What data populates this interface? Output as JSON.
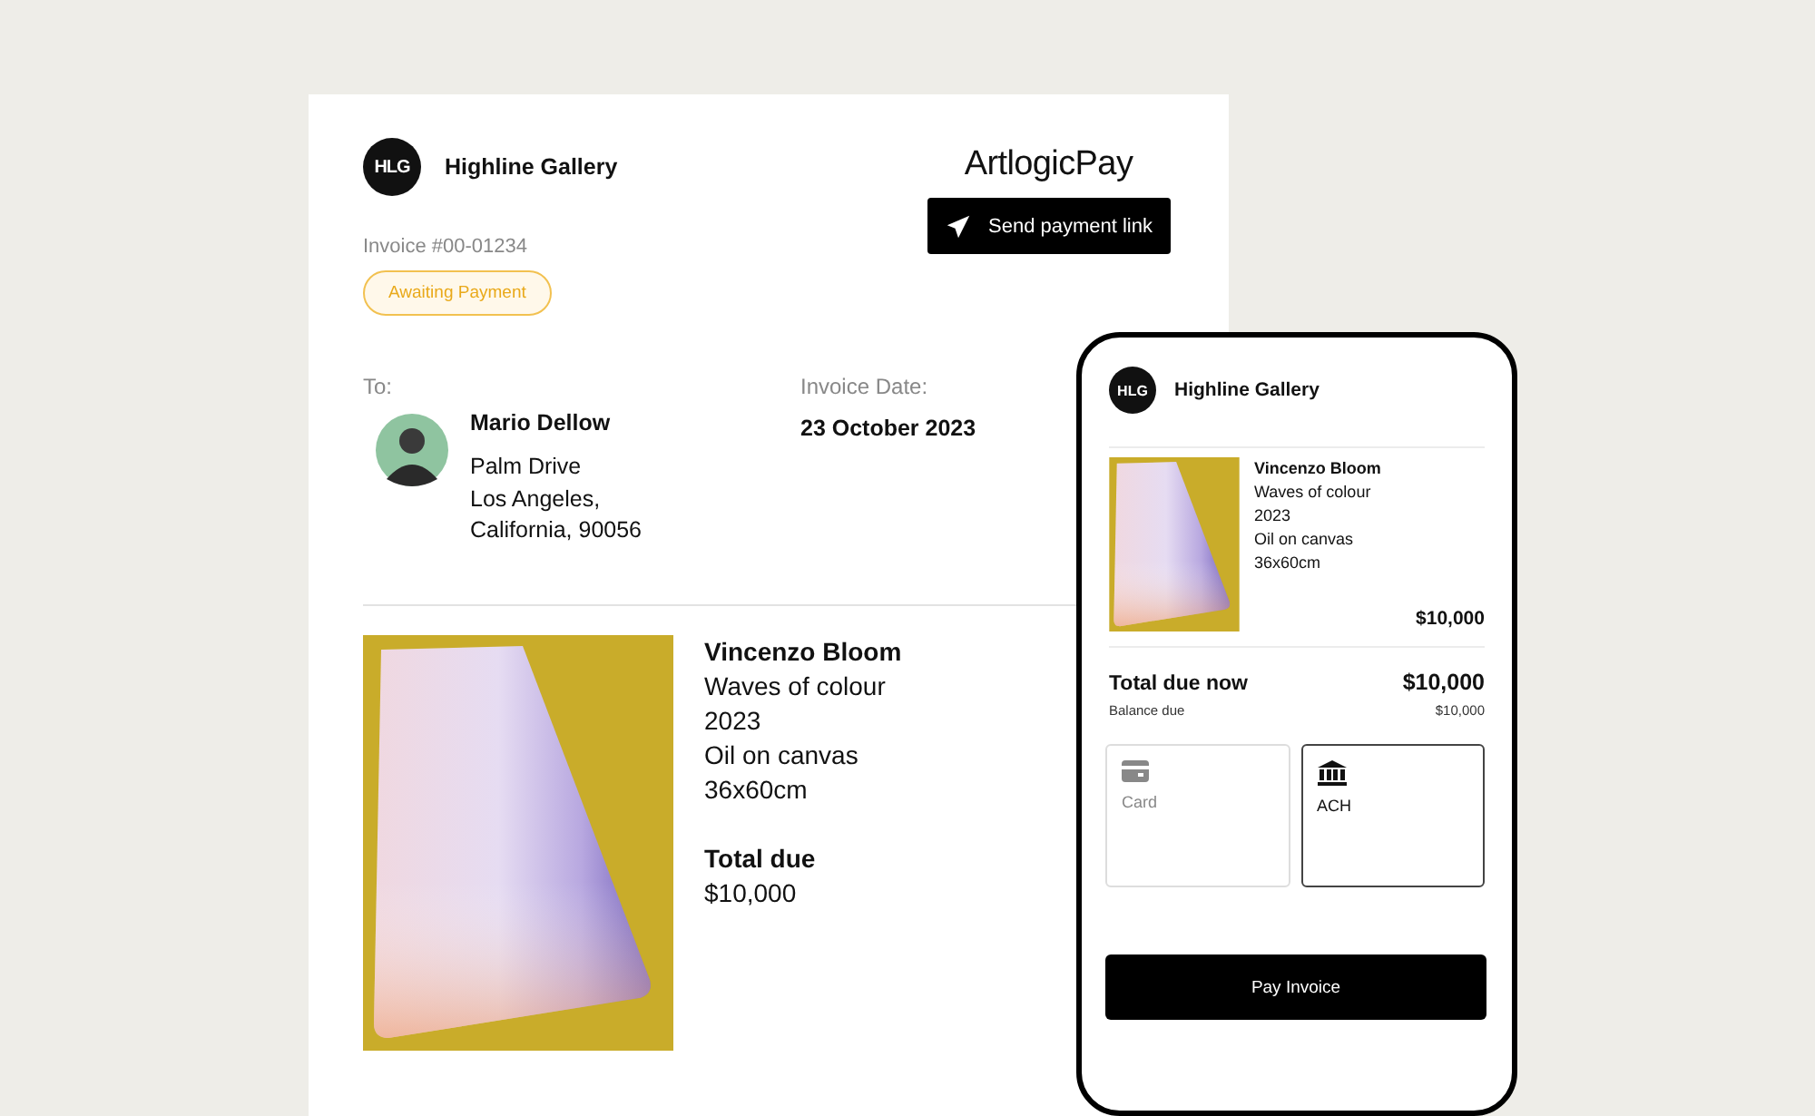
{
  "invoice": {
    "gallery": {
      "initials": "HLG",
      "name": "Highline Gallery"
    },
    "brand": "ArtlogicPay",
    "send_button": "Send payment link",
    "number": "Invoice #00-01234",
    "status": "Awaiting Payment",
    "to_label": "To:",
    "recipient": {
      "name": "Mario Dellow",
      "address": [
        "Palm Drive",
        "Los Angeles,",
        "California, 90056"
      ]
    },
    "date_label": "Invoice Date:",
    "date": "23 October 2023",
    "item": {
      "artist": "Vincenzo Bloom",
      "details": [
        "Waves of colour",
        "2023",
        "Oil on canvas",
        "36x60cm"
      ]
    },
    "total_label": "Total due",
    "total": "$10,000"
  },
  "phone": {
    "gallery": {
      "initials": "HLG",
      "name": "Highline Gallery"
    },
    "item": {
      "artist": "Vincenzo Bloom",
      "details": [
        "Waves of colour",
        "2023",
        "Oil on canvas",
        "36x60cm"
      ],
      "price": "$10,000"
    },
    "total_label": "Total due now",
    "total": "$10,000",
    "balance_label": "Balance due",
    "balance": "$10,000",
    "payment_methods": [
      {
        "kind": "card",
        "label": "Card",
        "selected": false
      },
      {
        "kind": "bank",
        "label": "ACH",
        "selected": true
      }
    ],
    "pay_button": "Pay Invoice"
  }
}
